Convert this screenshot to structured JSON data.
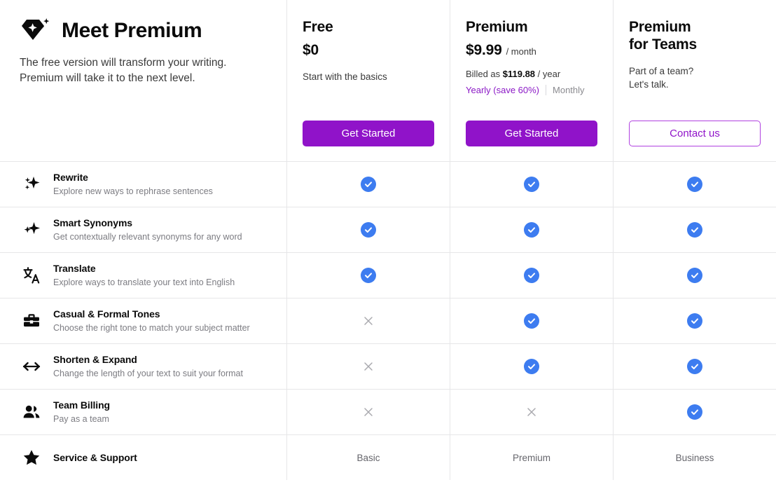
{
  "hero": {
    "icon": "gem-sparkle-icon",
    "title": "Meet Premium",
    "subtitle_line1": "The free version will transform your writing.",
    "subtitle_line2": "Premium will take it to the next level."
  },
  "colors": {
    "brand_purple": "#9013c9",
    "brand_purple_text": "#8b19c6",
    "check_blue": "#3d7cf0",
    "cross_gray": "#a9a9ae",
    "divider": "#e6e6e8",
    "muted_text": "#7c7c82"
  },
  "plans": [
    {
      "name": "Free",
      "price": "$0",
      "period": "",
      "tagline": "Start with the basics",
      "billed_prefix": "",
      "billed_amount": "",
      "billed_suffix": "",
      "toggle_yearly": "",
      "toggle_monthly": "",
      "cta_label": "Get Started",
      "cta_style": "filled"
    },
    {
      "name": "Premium",
      "price": "$9.99",
      "period": "/ month",
      "tagline": "",
      "billed_prefix": "Billed as ",
      "billed_amount": "$119.88",
      "billed_suffix": " / year",
      "toggle_yearly": "Yearly (save 60%)",
      "toggle_monthly": "Monthly",
      "cta_label": "Get Started",
      "cta_style": "filled"
    },
    {
      "name_line1": "Premium",
      "name_line2": "for Teams",
      "price": "",
      "period": "",
      "tagline_line1": "Part of a team?",
      "tagline_line2": "Let's talk.",
      "cta_label": "Contact us",
      "cta_style": "outline"
    }
  ],
  "features": [
    {
      "icon": "sparkles-icon",
      "title": "Rewrite",
      "desc": "Explore new ways to rephrase sentences",
      "free": "check",
      "premium": "check",
      "teams": "check"
    },
    {
      "icon": "sparkles-icon",
      "title": "Smart Synonyms",
      "desc": "Get contextually relevant synonyms for any word",
      "free": "check",
      "premium": "check",
      "teams": "check"
    },
    {
      "icon": "translate-icon",
      "title": "Translate",
      "desc": "Explore ways to translate your text into English",
      "free": "check",
      "premium": "check",
      "teams": "check"
    },
    {
      "icon": "toolbox-icon",
      "title": "Casual & Formal Tones",
      "desc": "Choose the right tone to match your subject matter",
      "free": "cross",
      "premium": "check",
      "teams": "check"
    },
    {
      "icon": "arrows-horizontal-icon",
      "title": "Shorten & Expand",
      "desc": "Change the length of your text to suit your format",
      "free": "cross",
      "premium": "check",
      "teams": "check"
    },
    {
      "icon": "people-icon",
      "title": "Team Billing",
      "desc": "Pay as a team",
      "free": "cross",
      "premium": "cross",
      "teams": "check"
    },
    {
      "icon": "star-icon",
      "title": "Service & Support",
      "desc": "",
      "free": "Basic",
      "premium": "Premium",
      "teams": "Business"
    }
  ]
}
